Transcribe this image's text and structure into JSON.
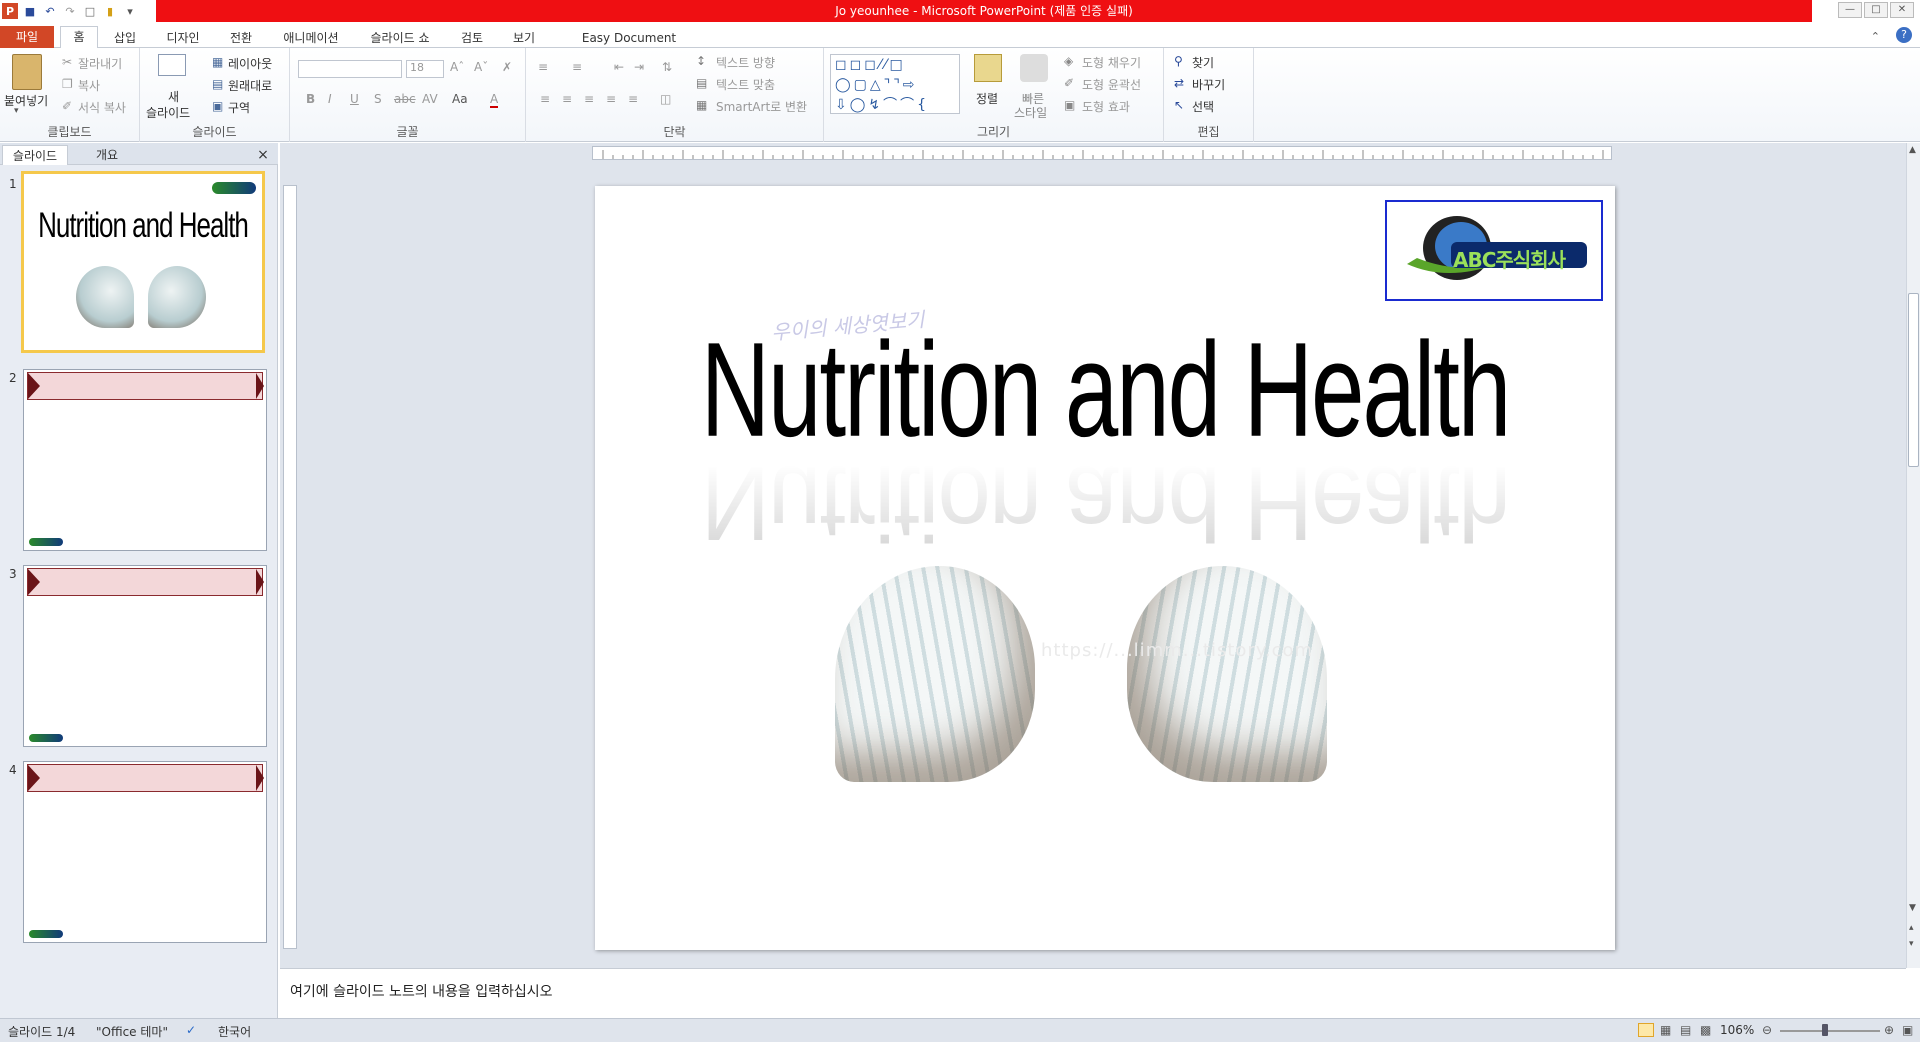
{
  "window": {
    "title": "Jo yeounhee - Microsoft PowerPoint (제품 인증 실패)",
    "titlebar_color": "#ef0f12"
  },
  "tabs": [
    "파일",
    "홈",
    "삽입",
    "디자인",
    "전환",
    "애니메이션",
    "슬라이드 쇼",
    "검토",
    "보기",
    "Easy Document Creator"
  ],
  "ribbon": {
    "clipboard": {
      "paste": "붙여넣기",
      "cut": "잘라내기",
      "copy": "복사",
      "format_painter": "서식 복사",
      "label": "클립보드"
    },
    "slides": {
      "new_slide_1": "새",
      "new_slide_2": "슬라이드",
      "layout": "레이아웃",
      "reset": "원래대로",
      "section": "구역",
      "label": "슬라이드"
    },
    "font": {
      "size": "18",
      "change_case": "Aa",
      "label": "글꼴"
    },
    "paragraph": {
      "text_direction": "텍스트 방향",
      "align_text": "텍스트 맞춤",
      "smartart": "SmartArt로 변환",
      "label": "단락"
    },
    "drawing": {
      "arrange": "정렬",
      "quick_styles_1": "빠른",
      "quick_styles_2": "스타일",
      "shape_fill": "도형 채우기",
      "shape_outline": "도형 윤곽선",
      "shape_effects": "도형 효과",
      "label": "그리기"
    },
    "editing": {
      "find": "찾기",
      "replace": "바꾸기",
      "select": "선택",
      "label": "편집"
    }
  },
  "pane": {
    "tab_slides": "슬라이드",
    "tab_outline": "개요",
    "close": "×",
    "thumbnails": [
      {
        "num": "1",
        "title": "Nutrition and Health"
      },
      {
        "num": "2"
      },
      {
        "num": "3"
      },
      {
        "num": "4"
      }
    ]
  },
  "slide": {
    "title": "Nutrition and Health",
    "logo_text": "ABC주식회사",
    "watermark_top": "우이의 세상엿보기",
    "watermark_url": "https://...limm...tistory.com"
  },
  "notes_placeholder": "여기에 슬라이드 노트의 내용을 입력하십시오",
  "status": {
    "slide": "슬라이드 1/4",
    "theme": "\"Office 테마\"",
    "language": "한국어",
    "zoom": "106%"
  }
}
